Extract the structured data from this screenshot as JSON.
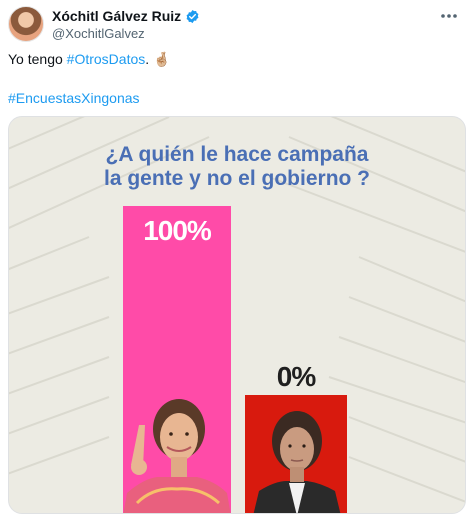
{
  "tweet": {
    "author_name": "Xóchitl Gálvez Ruiz",
    "handle": "@XochitlGalvez",
    "text_prefix": "Yo tengo ",
    "hashtag_1": "#OtrosDatos",
    "text_suffix": ". 🤞🏼",
    "hashtag_2": "#EncuestasXingonas",
    "verified_color": "#1d9bf0",
    "hashtag_color": "#1d9bf0"
  },
  "media": {
    "question_line_1": "¿A quién le hace campaña",
    "question_line_2": "la gente y no el gobierno ?",
    "icons": [
      "verified-badge-icon",
      "more-options-icon"
    ]
  },
  "chart_data": {
    "type": "bar",
    "title": "¿A quién le hace campaña la gente y no el gobierno ?",
    "categories": [
      "",
      ""
    ],
    "values": [
      100,
      0
    ],
    "value_labels": [
      "100%",
      "0%"
    ],
    "colors": [
      "#ff4ba8",
      "#d81a0e"
    ],
    "ylim": [
      0,
      100
    ]
  }
}
